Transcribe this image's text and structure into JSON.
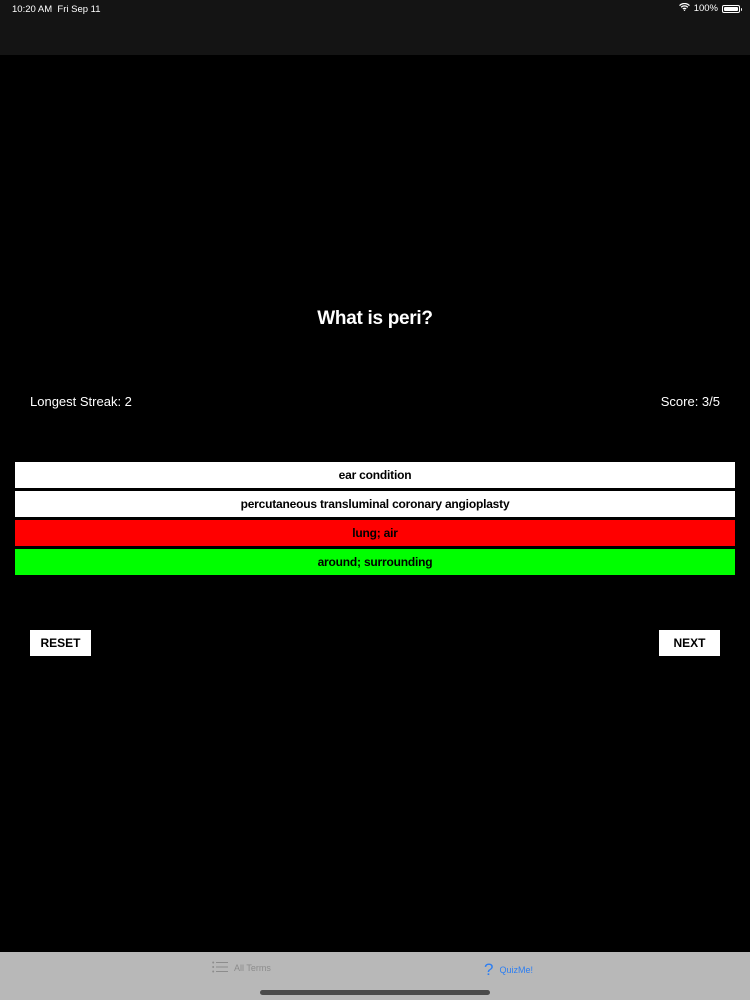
{
  "status_bar": {
    "time": "10:20 AM",
    "date": "Fri Sep 11",
    "battery": "100%"
  },
  "quiz": {
    "question": "What is peri?",
    "longest_streak": "Longest Streak: 2",
    "score": "Score: 3/5",
    "answers": [
      {
        "label": "ear condition",
        "color": "#ffffff"
      },
      {
        "label": "percutaneous transluminal coronary angioplasty",
        "color": "#ffffff"
      },
      {
        "label": "lung; air",
        "color": "#ff0000"
      },
      {
        "label": "around; surrounding",
        "color": "#00ff00"
      }
    ],
    "reset_label": "RESET",
    "next_label": "NEXT"
  },
  "tab_bar": {
    "tabs": [
      {
        "label": "All Terms",
        "icon": "list-icon",
        "active": false
      },
      {
        "label": "QuizMe!",
        "icon": "question-mark-icon",
        "active": true
      }
    ]
  },
  "colors": {
    "background": "#000000",
    "bar": "#141414",
    "tab_bar": "#b8b8b8",
    "tab_active": "#2c7ef2",
    "tab_inactive": "#8c8c8c",
    "wrong": "#ff0000",
    "correct": "#00ff00"
  }
}
